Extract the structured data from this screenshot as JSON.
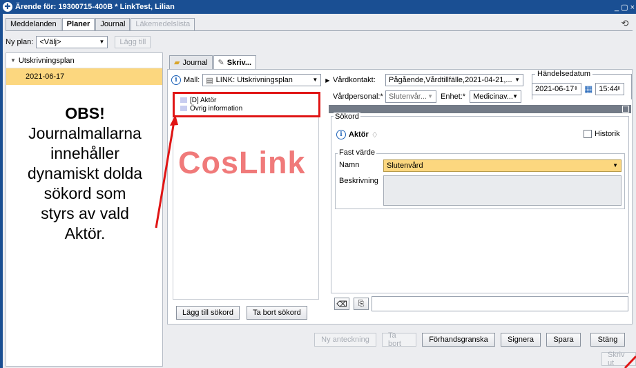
{
  "window": {
    "title": "Ärende för: 19300715-400B * LinkTest, Lilian",
    "controls": "_ ▢ ×"
  },
  "top_tabs": [
    {
      "label": "Meddelanden"
    },
    {
      "label": "Planer"
    },
    {
      "label": "Journal"
    },
    {
      "label": "Läkemedelslista"
    }
  ],
  "nyplan": {
    "label": "Ny plan:",
    "value": "<Välj>",
    "add_button": "Lägg till"
  },
  "plans": {
    "group": "Utskrivningsplan",
    "items": [
      {
        "label": "2021-06-17"
      }
    ]
  },
  "annotation": {
    "title": "OBS!",
    "text_lines": [
      "Journalmallarna",
      "innehåller",
      "dynamiskt dolda",
      "sökord som",
      "styrs av vald",
      "Aktör."
    ]
  },
  "content_tabs": [
    {
      "label": "Journal"
    },
    {
      "label": "Skriv..."
    }
  ],
  "mall": {
    "label": "Mall:",
    "value": "LINK: Utskrivningsplan"
  },
  "template_items": [
    {
      "label": "[D] Aktör"
    },
    {
      "label": "Övrig information"
    }
  ],
  "watermark": "CosLink",
  "sokord_buttons": {
    "add": "Lägg till sökord",
    "remove": "Ta bort sökord"
  },
  "vardkontakt": {
    "label": "Vårdkontakt:",
    "value": "Pågående,Vårdtillfälle,2021-04-21,..."
  },
  "vardpersonal": {
    "label": "Vårdpersonal:*",
    "value": "Slutenvår...",
    "enhet_label": "Enhet:*",
    "enhet_value": "Medicinav..."
  },
  "handelsedatum": {
    "label": "Händelsedatum",
    "date": "2021-06-17",
    "time": "15:44"
  },
  "sokord": {
    "legend": "Sökord",
    "aktor_label": "Aktör",
    "historik_label": "Historik",
    "fast_varde_legend": "Fast värde",
    "namn_label": "Namn",
    "namn_value": "Slutenvård",
    "beskrivning_label": "Beskrivning"
  },
  "bottom_buttons": [
    {
      "label": "Ny anteckning"
    },
    {
      "label": "Ta bort"
    },
    {
      "label": "Förhandsgranska"
    },
    {
      "label": "Signera"
    },
    {
      "label": "Spara"
    },
    {
      "label": "Stäng"
    }
  ],
  "skriv_ut": "Skriv ut",
  "colors": {
    "title_bar": "#1a4f93",
    "selection": "#fcd77f",
    "highlight_red": "#e01515",
    "watermark": "#f07a7a"
  }
}
